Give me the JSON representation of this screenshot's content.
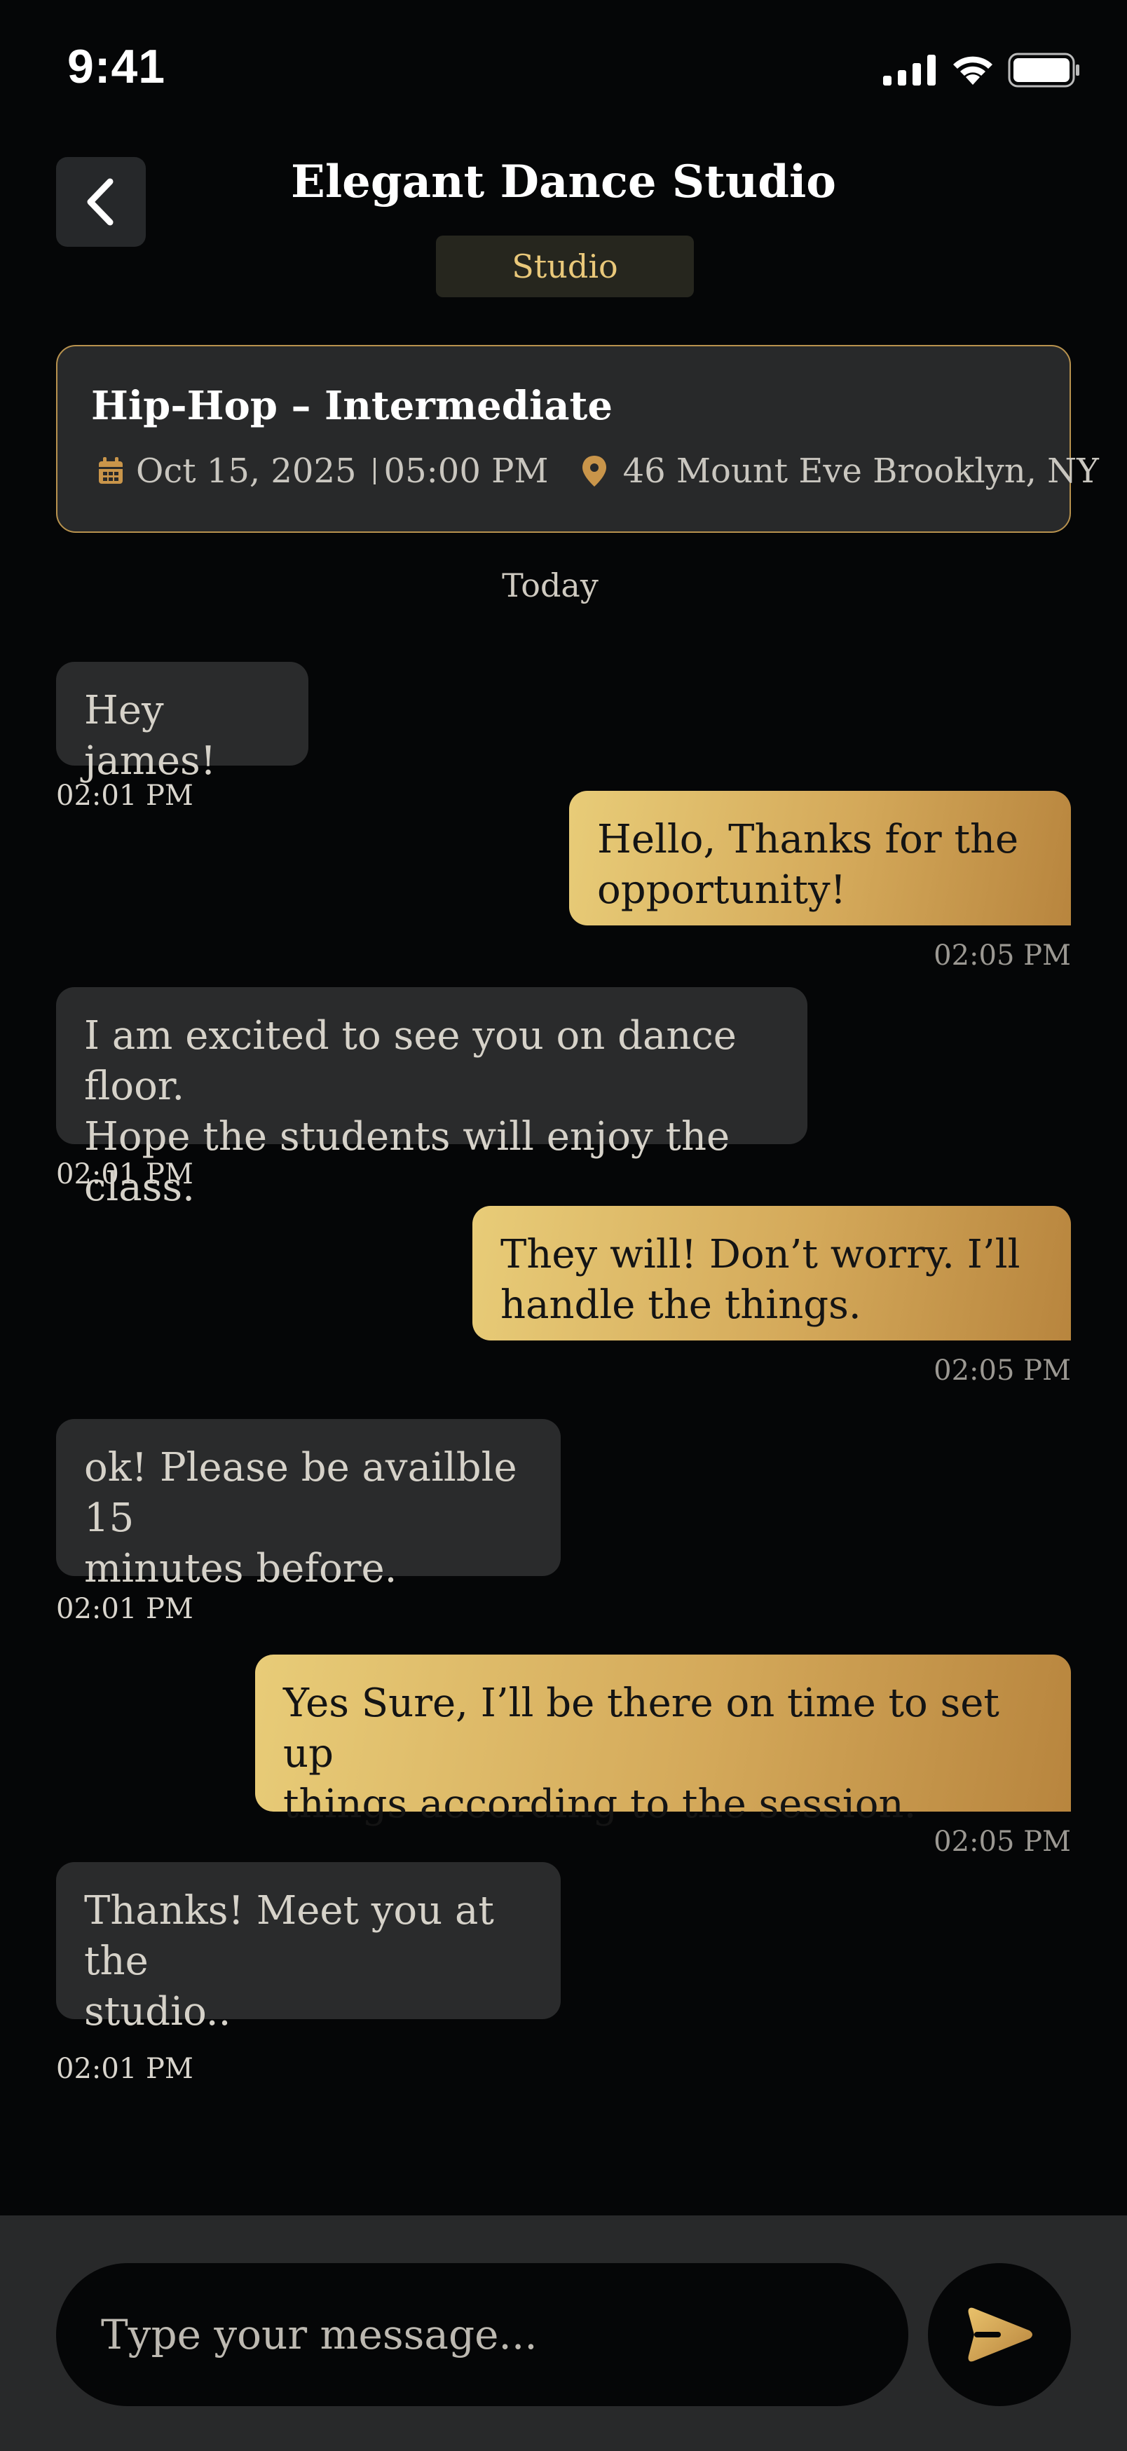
{
  "status_bar": {
    "time": "9:41"
  },
  "header": {
    "title": "Elegant Dance Studio",
    "badge": "Studio"
  },
  "class_card": {
    "title": "Hip-Hop – Intermediate",
    "date": "Oct 15, 2025",
    "time": "05:00 PM",
    "location": "46 Mount Eve Brooklyn, NY"
  },
  "day_divider": "Today",
  "messages": [
    {
      "direction": "incoming",
      "lines": [
        "Hey james!"
      ],
      "time": "02:01 PM"
    },
    {
      "direction": "outgoing",
      "lines": [
        "Hello, Thanks for the",
        "opportunity!"
      ],
      "time": "02:05 PM"
    },
    {
      "direction": "incoming",
      "lines": [
        "I am excited to see you on dance floor.",
        "Hope the students will enjoy the class."
      ],
      "time": "02:01 PM"
    },
    {
      "direction": "outgoing",
      "lines": [
        "They will! Don’t worry. I’ll",
        "handle the things."
      ],
      "time": "02:05 PM"
    },
    {
      "direction": "incoming",
      "lines": [
        "ok! Please be availble 15",
        "minutes before."
      ],
      "time": "02:01 PM"
    },
    {
      "direction": "outgoing",
      "lines": [
        "Yes Sure, I’ll be there on time to set up",
        "things according to the session."
      ],
      "time": "02:05 PM"
    },
    {
      "direction": "incoming",
      "lines": [
        "Thanks! Meet you at the",
        "studio.."
      ],
      "time": "02:01 PM"
    }
  ],
  "composer": {
    "placeholder": "Type your message..."
  },
  "colors": {
    "accent": "#d4a95a",
    "background": "#050607",
    "bubble_incoming": "#2a2b2c"
  },
  "icons": [
    "cellular-signal-icon",
    "wifi-icon",
    "battery-icon",
    "chevron-left-icon",
    "calendar-icon",
    "location-pin-icon",
    "send-icon"
  ]
}
